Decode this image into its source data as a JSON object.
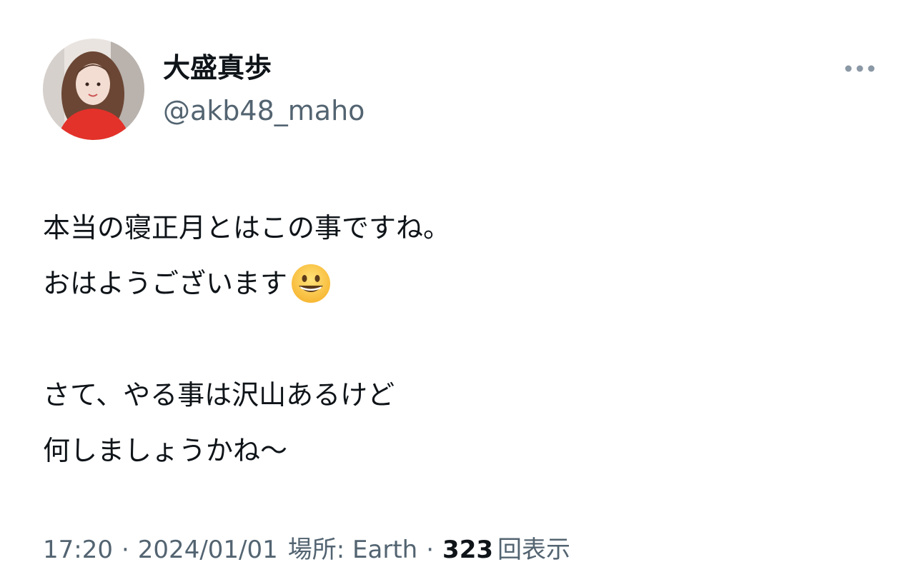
{
  "author": {
    "display_name": "大盛真歩",
    "handle": "@akb48_maho",
    "avatar_icon": "profile-photo"
  },
  "more_icon": "more-horizontal-icon",
  "tweet": {
    "lines": [
      "本当の寝正月とはこの事ですね。",
      "おはようございます",
      "",
      "さて、やる事は沢山あるけど",
      "何しましょうかね〜"
    ],
    "emoji_icon": "grinning-face-emoji"
  },
  "meta": {
    "time": "17:20",
    "separator": "·",
    "date": "2024/01/01",
    "location": "場所: Earth",
    "views_count": "323",
    "views_label": "回表示"
  },
  "colors": {
    "text_primary": "#0f1419",
    "text_secondary": "#536471",
    "background": "#ffffff"
  }
}
